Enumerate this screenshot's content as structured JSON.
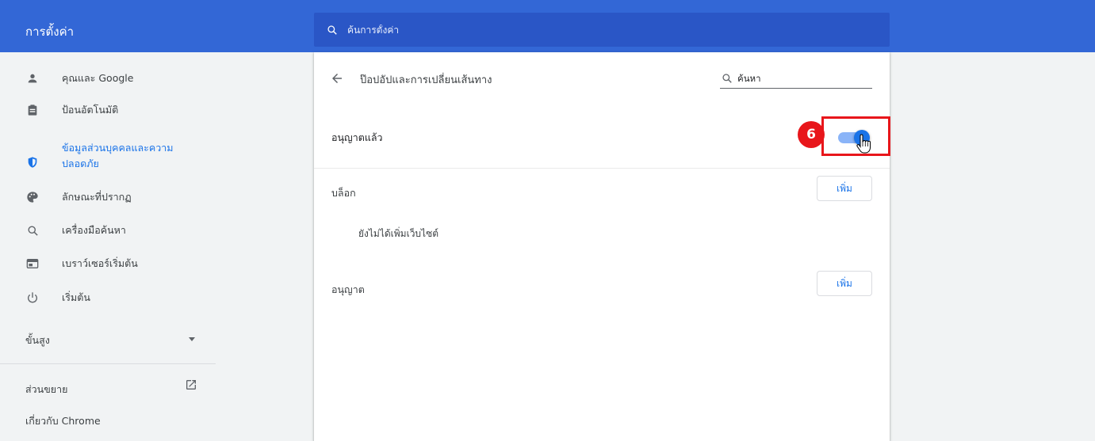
{
  "header": {
    "title": "การตั้งค่า",
    "search_placeholder": "ค้นการตั้งค่า"
  },
  "sidebar": {
    "items": [
      {
        "label": "คุณและ Google",
        "icon": "person-icon"
      },
      {
        "label": "ป้อนอัตโนมัติ",
        "icon": "clipboard-icon"
      },
      {
        "label": "ข้อมูลส่วนบุคคลและความ",
        "label2": "ปลอดภัย",
        "icon": "shield-icon",
        "active": true
      },
      {
        "label": "ลักษณะที่ปรากฏ",
        "icon": "palette-icon"
      },
      {
        "label": "เครื่องมือค้นหา",
        "icon": "search-icon"
      },
      {
        "label": "เบราว์เซอร์เริ่มต้น",
        "icon": "browser-icon"
      },
      {
        "label": "เริ่มต้น",
        "icon": "power-icon"
      }
    ],
    "advanced_label": "ขั้นสูง",
    "extensions_label": "ส่วนขยาย",
    "about_label": "เกี่ยวกับ Chrome"
  },
  "page": {
    "title": "ป๊อปอัปและการเปลี่ยนเส้นทาง",
    "search_placeholder": "ค้นหา",
    "allowed_label": "อนุญาตแล้ว",
    "toggle_on": true,
    "block_label": "บล็อก",
    "block_add_label": "เพิ่ม",
    "block_empty_text": "ยังไม่ได้เพิ่มเว็บไซต์",
    "allow_label": "อนุญาต",
    "allow_add_label": "เพิ่ม"
  },
  "annotation": {
    "step_number": "6"
  },
  "colors": {
    "header_bg": "#3367d6",
    "search_bg": "#2a56c6",
    "accent": "#1a73e8",
    "annotation_red": "#e8161b"
  }
}
